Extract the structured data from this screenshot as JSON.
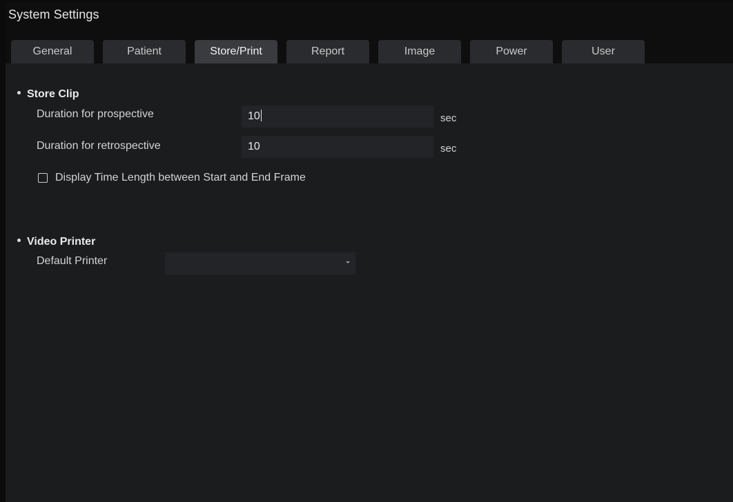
{
  "window": {
    "title": "System Settings"
  },
  "tabs": [
    {
      "label": "General"
    },
    {
      "label": "Patient"
    },
    {
      "label": "Store/Print"
    },
    {
      "label": "Report"
    },
    {
      "label": "Image"
    },
    {
      "label": "Power"
    },
    {
      "label": "User"
    }
  ],
  "active_tab": "Store/Print",
  "store_clip": {
    "heading": "Store Clip",
    "prospective": {
      "label": "Duration for prospective",
      "value": "10",
      "unit": "sec"
    },
    "retrospective": {
      "label": "Duration for retrospective",
      "value": "10",
      "unit": "sec"
    },
    "display_time_length": {
      "label": "Display Time Length between Start and End Frame",
      "checked": false
    }
  },
  "video_printer": {
    "heading": "Video Printer",
    "default_printer": {
      "label": "Default Printer",
      "value": ""
    }
  },
  "colors": {
    "background": "#1b1c1e",
    "title_bar": "#0e0e0f",
    "tab": "#2a2b2e",
    "tab_active": "#3a3b3f",
    "input": "#232427",
    "text": "#d4d4d4"
  },
  "icons": {
    "bullet": "bullet-icon",
    "dropdown": "chevron-down-icon",
    "checkbox": "checkbox-icon"
  }
}
